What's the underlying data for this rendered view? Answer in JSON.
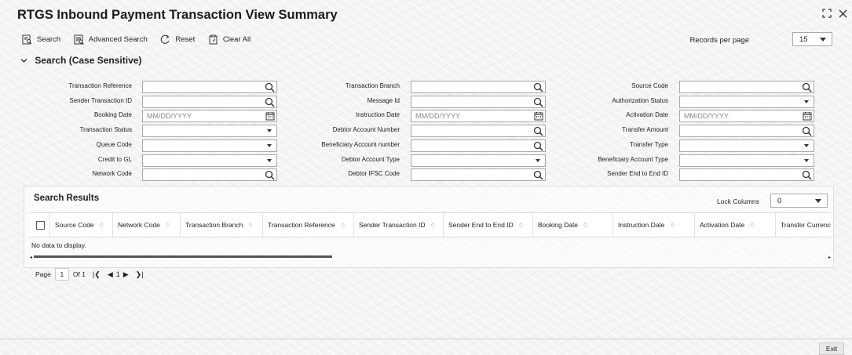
{
  "window": {
    "title": "RTGS Inbound Payment Transaction View Summary"
  },
  "toolbar": {
    "search": "Search",
    "advanced_search": "Advanced Search",
    "reset": "Reset",
    "clear_all": "Clear All",
    "records_per_page_label": "Records per page",
    "records_per_page_value": "15"
  },
  "search_section": {
    "title": "Search (Case Sensitive)"
  },
  "form": {
    "col1": [
      {
        "label": "Transaction Reference",
        "type": "lookup",
        "value": ""
      },
      {
        "label": "Sender Transaction ID",
        "type": "lookup",
        "value": ""
      },
      {
        "label": "Booking Date",
        "type": "date",
        "placeholder": "MM/DD/YYYY"
      },
      {
        "label": "Transaction Status",
        "type": "select",
        "value": ""
      },
      {
        "label": "Queue Code",
        "type": "select",
        "value": ""
      },
      {
        "label": "Credit to GL",
        "type": "select",
        "value": ""
      },
      {
        "label": "Network Code",
        "type": "lookup",
        "value": ""
      }
    ],
    "col2": [
      {
        "label": "Transaction Branch",
        "type": "lookup",
        "value": ""
      },
      {
        "label": "Message Id",
        "type": "lookup",
        "value": ""
      },
      {
        "label": "Instruction Date",
        "type": "date",
        "placeholder": "MM/DD/YYYY"
      },
      {
        "label": "Debtor Account Number",
        "type": "lookup",
        "value": ""
      },
      {
        "label": "Beneficiary Account number",
        "type": "lookup",
        "value": ""
      },
      {
        "label": "Debtor Account Type",
        "type": "select",
        "value": ""
      },
      {
        "label": "Debtor IFSC Code",
        "type": "lookup",
        "value": ""
      }
    ],
    "col3": [
      {
        "label": "Source Code",
        "type": "lookup",
        "value": ""
      },
      {
        "label": "Authorization Status",
        "type": "select",
        "value": ""
      },
      {
        "label": "Activation Date",
        "type": "date",
        "placeholder": "MM/DD/YYYY"
      },
      {
        "label": "Transfer Amount",
        "type": "lookup",
        "value": ""
      },
      {
        "label": "Transfer Type",
        "type": "select",
        "value": ""
      },
      {
        "label": "Beneficiary Account Type",
        "type": "select",
        "value": ""
      },
      {
        "label": "Sender End to End ID",
        "type": "lookup",
        "value": ""
      }
    ]
  },
  "results": {
    "title": "Search Results",
    "lock_columns_label": "Lock Columns",
    "lock_columns_value": "0",
    "columns": [
      "Source Code",
      "Network Code",
      "Transaction Branch",
      "Transaction Reference",
      "Sender Transaction ID",
      "Sender End to End ID",
      "Booking Date",
      "Instruction Date",
      "Activation Date",
      "Transfer Currency"
    ],
    "empty_message": "No data to display."
  },
  "pager": {
    "page_label": "Page",
    "page_value": "1",
    "of_label": "Of 1",
    "current": "1"
  },
  "footer": {
    "exit": "Exit"
  }
}
